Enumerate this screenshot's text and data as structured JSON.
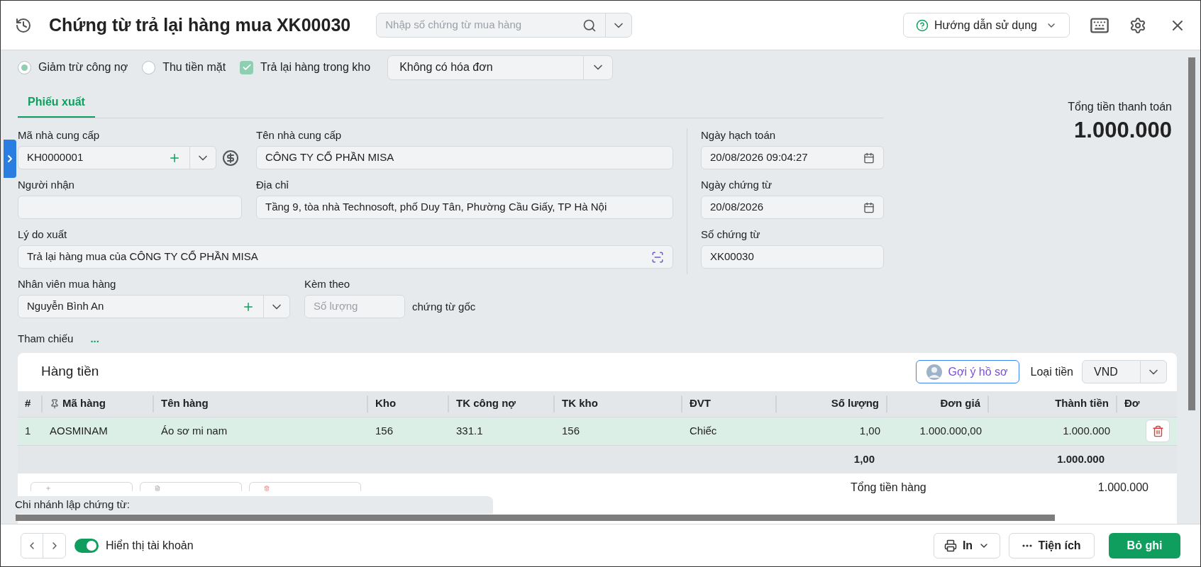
{
  "header": {
    "title": "Chứng từ trả lại hàng mua XK00030",
    "search_placeholder": "Nhập số chứng từ mua hàng",
    "help_button": "Hướng dẫn sử dụng"
  },
  "options": {
    "radios": [
      {
        "label": "Giảm trừ công nợ",
        "selected": true
      },
      {
        "label": "Thu tiền mặt",
        "selected": false
      }
    ],
    "checkbox": {
      "label": "Trả lại hàng trong kho",
      "checked": true,
      "disabled": true
    },
    "invoice_select": "Không có hóa đơn"
  },
  "tabs": [
    {
      "label": "Phiếu xuất",
      "selected": true
    }
  ],
  "form": {
    "supplier_code": {
      "label": "Mã nhà cung cấp",
      "value": "KH0000001"
    },
    "supplier_name": {
      "label": "Tên nhà cung cấp",
      "value": "CÔNG TY CỔ PHẦN MISA"
    },
    "receiver": {
      "label": "Người nhận"
    },
    "address": {
      "label": "Địa chỉ",
      "value": "Tầng 9, tòa nhà Technosoft, phố Duy Tân, Phường Cầu Giấy, TP Hà Nội"
    },
    "reason": {
      "label": "Lý do xuất",
      "value": "Trả lại hàng mua của CÔNG TY CỔ PHẦN MISA"
    },
    "purchaser": {
      "label": "Nhân viên mua hàng",
      "value": "Nguyễn Bình An"
    },
    "attachments": {
      "label": "Kèm theo",
      "placeholder": "Số lượng",
      "suffix": "chứng từ gốc"
    },
    "reference": {
      "label": "Tham chiếu",
      "link": "..."
    },
    "posting_date": {
      "label": "Ngày hạch toán",
      "value": "20/08/2026 09:04:27"
    },
    "voucher_date": {
      "label": "Ngày chứng từ",
      "value": "20/08/2026"
    },
    "voucher_no": {
      "label": "Số chứng từ",
      "value": "XK00030"
    }
  },
  "total": {
    "label": "Tổng tiền thanh toán",
    "value": "1.000.000"
  },
  "grid": {
    "title": "Hàng tiền",
    "suggest_button": "Gợi ý hồ sơ",
    "currency_label": "Loại tiền",
    "currency": "VND",
    "columns": [
      {
        "label": "#",
        "pinned": false
      },
      {
        "label": "Mã hàng",
        "pinned": true
      },
      {
        "label": "Tên hàng",
        "pinned": false
      },
      {
        "label": "Kho",
        "pinned": false
      },
      {
        "label": "TK công nợ",
        "pinned": false
      },
      {
        "label": "TK kho",
        "pinned": false
      },
      {
        "label": "ĐVT",
        "pinned": false
      },
      {
        "label": "Số lượng",
        "pinned": false
      },
      {
        "label": "Đơn giá",
        "pinned": false
      },
      {
        "label": "Thành tiền",
        "pinned": false
      },
      {
        "label": "Đơ",
        "pinned": false
      }
    ],
    "rows": [
      {
        "selected": true,
        "cells": [
          "1",
          "AOSMINAM",
          "Áo sơ mi nam",
          "156",
          "331.1",
          "156",
          "Chiếc",
          "1,00",
          "1.000.000,00",
          "1.000.000"
        ]
      }
    ],
    "summary": {
      "quantity": "1,00",
      "amount": "1.000.000"
    },
    "totals": [
      {
        "label": "Tổng tiền hàng",
        "value": "1.000.000"
      }
    ]
  },
  "branch_label": "Chi nhánh lập chứng từ:",
  "footer": {
    "toggle": {
      "label": "Hiển thị tài khoản",
      "on": true
    },
    "buttons": [
      {
        "kind": "print",
        "label": "In"
      },
      {
        "kind": "more",
        "label": "Tiện ích"
      },
      {
        "kind": "primary",
        "label": "Bỏ ghi"
      }
    ]
  }
}
